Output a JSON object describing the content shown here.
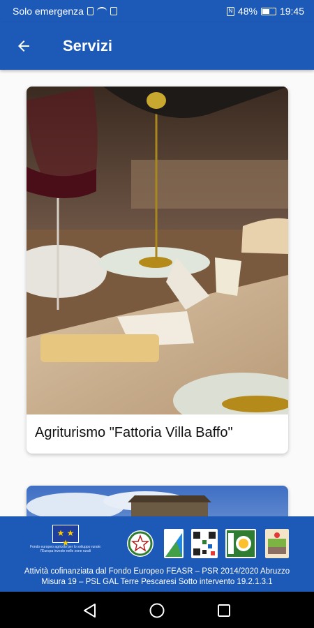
{
  "status_bar": {
    "carrier": "Solo emergenza",
    "battery": "48%",
    "time": "19:45",
    "icons": [
      "sim-icon",
      "wifi-icon",
      "lock-icon",
      "nfc-icon",
      "battery-icon"
    ]
  },
  "app_bar": {
    "title": "Servizi",
    "back_icon": "arrow-back-icon",
    "background": "#1d5ab8"
  },
  "cards": [
    {
      "title": "Agriturismo \"Fattoria Villa Baffo\"",
      "image": "photo-cheese-oil-wine"
    },
    {
      "title": "",
      "image": "photo-landscape-sky"
    }
  ],
  "footer": {
    "eu_caption_1": "Fondo europeo agricolo per lo sviluppo rurale:",
    "eu_caption_2": "l'Europa investe nelle zone rurali",
    "line1": "Attività cofinanziata dal Fondo Europeo FEASR – PSR 2014/2020 Abruzzo",
    "line2": "Misura 19 – PSL GAL Terre Pescaresi Sotto intervento 19.2.1.3.1",
    "logos": [
      "eu-flag-logo",
      "italian-republic-emblem",
      "abruzzo-region-logo",
      "qr-code",
      "leader-logo",
      "gal-terre-pescaresi-logo"
    ]
  },
  "nav_bar": {
    "buttons": [
      "back-triangle-icon",
      "home-circle-icon",
      "recent-square-icon"
    ]
  }
}
